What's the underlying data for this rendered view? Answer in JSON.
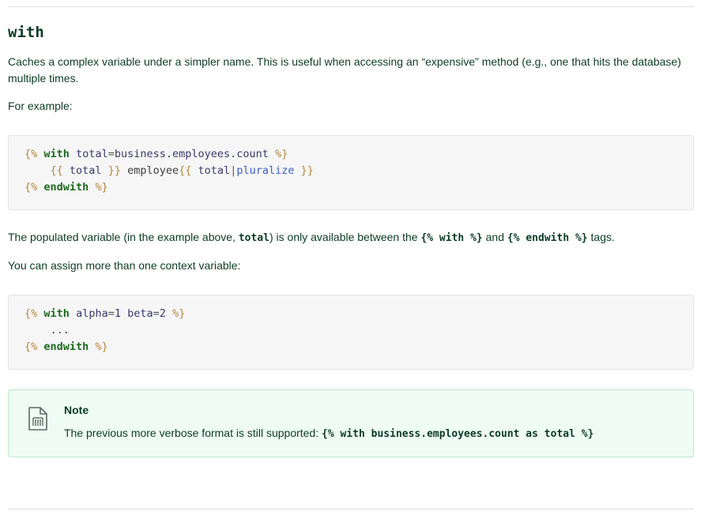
{
  "heading": "with",
  "intro": "Caches a complex variable under a simpler name. This is useful when accessing an “expensive” method (e.g., one that hits the database) multiple times.",
  "for_example": "For example:",
  "code1": {
    "l1": {
      "open": "{%",
      "kw": "with",
      "var": "total",
      "eq": "=",
      "val": "business.employees.count",
      "close": "%}"
    },
    "l2": {
      "indent": "    ",
      "o1": "{{",
      "v1": "total",
      "c1": "}}",
      "txt": "employee",
      "o2": "{{",
      "v2": "total",
      "pipe": "|",
      "filter": "pluralize",
      "c2": "}}"
    },
    "l3": {
      "open": "{%",
      "kw": "endwith",
      "close": "%}"
    }
  },
  "populated": {
    "part1": "The populated variable (in the example above, ",
    "code_total": "total",
    "part2": ") is only available between the ",
    "code_with": "{% with %}",
    "part3": " and ",
    "code_endwith": "{% endwith %}",
    "part4": " tags."
  },
  "assign_more": "You can assign more than one context variable:",
  "code2": {
    "l1": {
      "open": "{%",
      "kw": "with",
      "v1": "alpha",
      "eq1": "=",
      "n1": "1",
      "v2": "beta",
      "eq2": "=",
      "n2": "2",
      "close": "%}"
    },
    "l2": {
      "indent": "    ",
      "dots": "..."
    },
    "l3": {
      "open": "{%",
      "kw": "endwith",
      "close": "%}"
    }
  },
  "note": {
    "icon": "document-note-icon",
    "title": "Note",
    "text": "The previous more verbose format is still supported: ",
    "code": "{% with business.employees.count as total %}"
  },
  "colors": {
    "text": "#0c3c26",
    "code_bg": "#f6f6f7",
    "note_bg": "#effcf4",
    "note_border": "#bfe7cc",
    "keyword": "#1d6b1d",
    "delimiter": "#b8863b",
    "filter": "#3a5ec8"
  }
}
